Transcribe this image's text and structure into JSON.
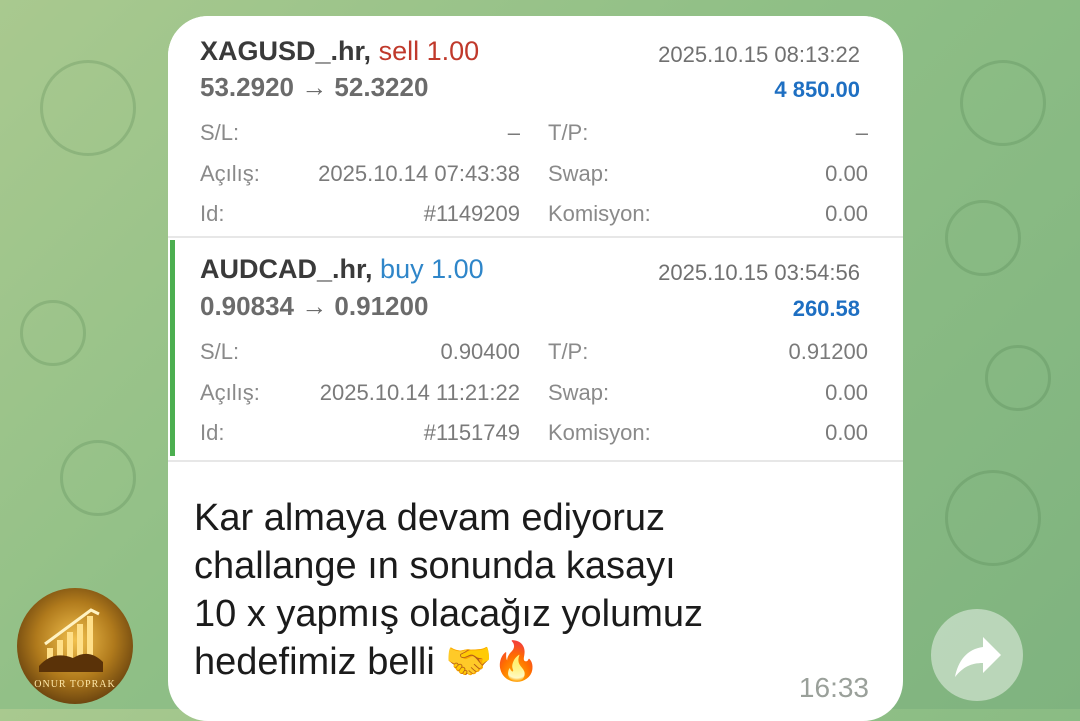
{
  "trades": [
    {
      "symbol": "XAGUSD_.hr,",
      "side": "sell 1.00",
      "side_type": "sell",
      "accent_color": "#ffffff",
      "prices": "53.2920 → 52.3220",
      "time": "2025.10.15 08:13:22",
      "profit": "4 850.00",
      "sl_label": "S/L:",
      "sl": "–",
      "tp_label": "T/P:",
      "tp": "–",
      "open_label": "Açılış:",
      "open": "2025.10.14 07:43:38",
      "swap_label": "Swap:",
      "swap": "0.00",
      "id_label": "Id:",
      "id": "#1149209",
      "commission_label": "Komisyon:",
      "commission": "0.00"
    },
    {
      "symbol": "AUDCAD_.hr,",
      "side": "buy 1.00",
      "side_type": "buy",
      "accent_color": "#4caf50",
      "prices": "0.90834 → 0.91200",
      "time": "2025.10.15 03:54:56",
      "profit": "260.58",
      "sl_label": "S/L:",
      "sl": "0.90400",
      "tp_label": "T/P:",
      "tp": "0.91200",
      "open_label": "Açılış:",
      "open": "2025.10.14 11:21:22",
      "swap_label": "Swap:",
      "swap": "0.00",
      "id_label": "Id:",
      "id": "#1151749",
      "commission_label": "Komisyon:",
      "commission": "0.00"
    }
  ],
  "message": {
    "lines": [
      "Kar almaya devam ediyoruz",
      "challange ın sonunda kasayı",
      "10 x yapmış olacağız yolumuz",
      "hedefimiz belli 🤝🔥"
    ],
    "time": "16:33"
  },
  "sender": {
    "avatar_text": "ONUR TOPRAK"
  },
  "colors": {
    "sell": "#c0392b",
    "buy": "#2f86c9",
    "profit": "#1e6fc2",
    "background": "#8fbf86"
  },
  "icons": {
    "share": "share-arrow-icon",
    "avatar": "bull-logo-icon"
  }
}
